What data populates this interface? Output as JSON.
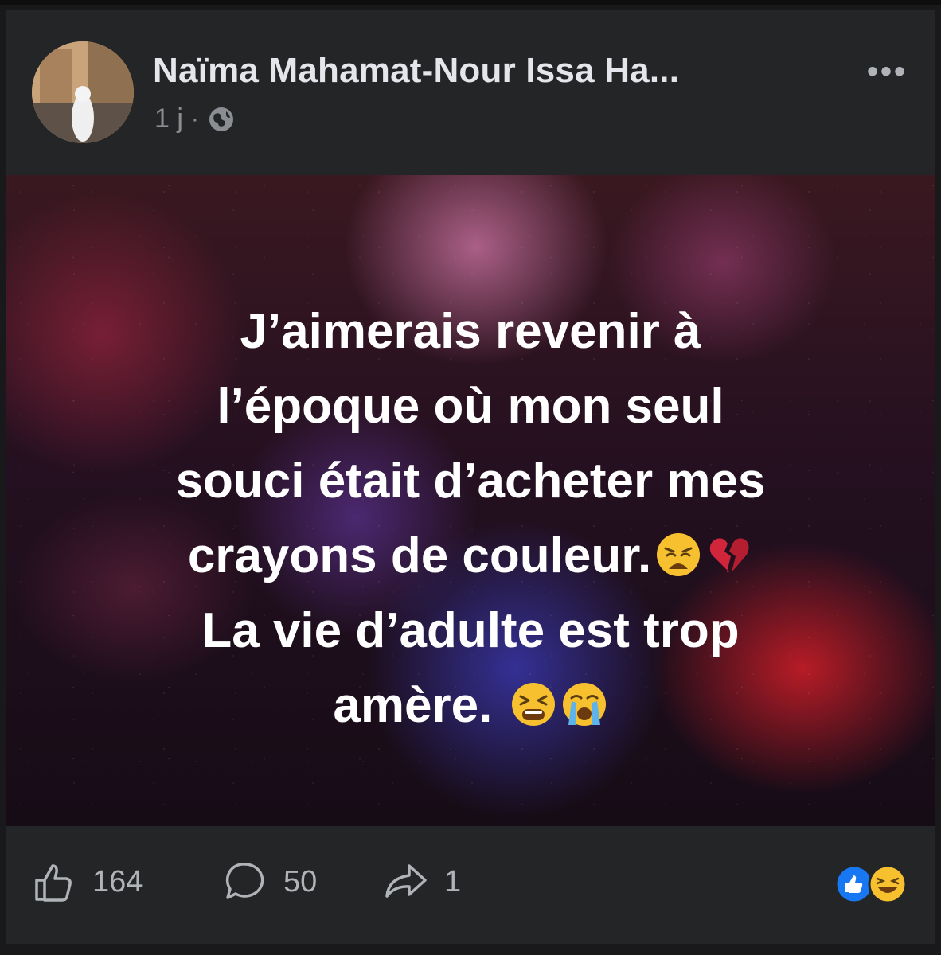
{
  "post": {
    "author": "Naïma Mahamat-Nour Issa Ha...",
    "time": "1 j",
    "separator": "·",
    "audience_icon": "globe-icon",
    "more_icon": "more-options-icon",
    "more_label": "•••"
  },
  "card": {
    "lines": [
      "J’aimerais revenir à",
      "l’époque où mon seul",
      "souci était d’acheter mes",
      "crayons de couleur.",
      "La vie d’adulte est trop",
      "amère."
    ],
    "emojis": [
      "weary-face",
      "broken-heart",
      "tired-face",
      "loudly-crying-face"
    ]
  },
  "footer": {
    "likes": "164",
    "comments": "50",
    "shares": "1",
    "like_icon": "like-icon",
    "comment_icon": "comment-icon",
    "share_icon": "share-icon",
    "reactions": [
      "like-reaction",
      "haha-reaction"
    ]
  },
  "colors": {
    "background": "#242526",
    "text": "#e4e6eb",
    "muted": "#8a8d91",
    "like_blue": "#1877f2"
  }
}
